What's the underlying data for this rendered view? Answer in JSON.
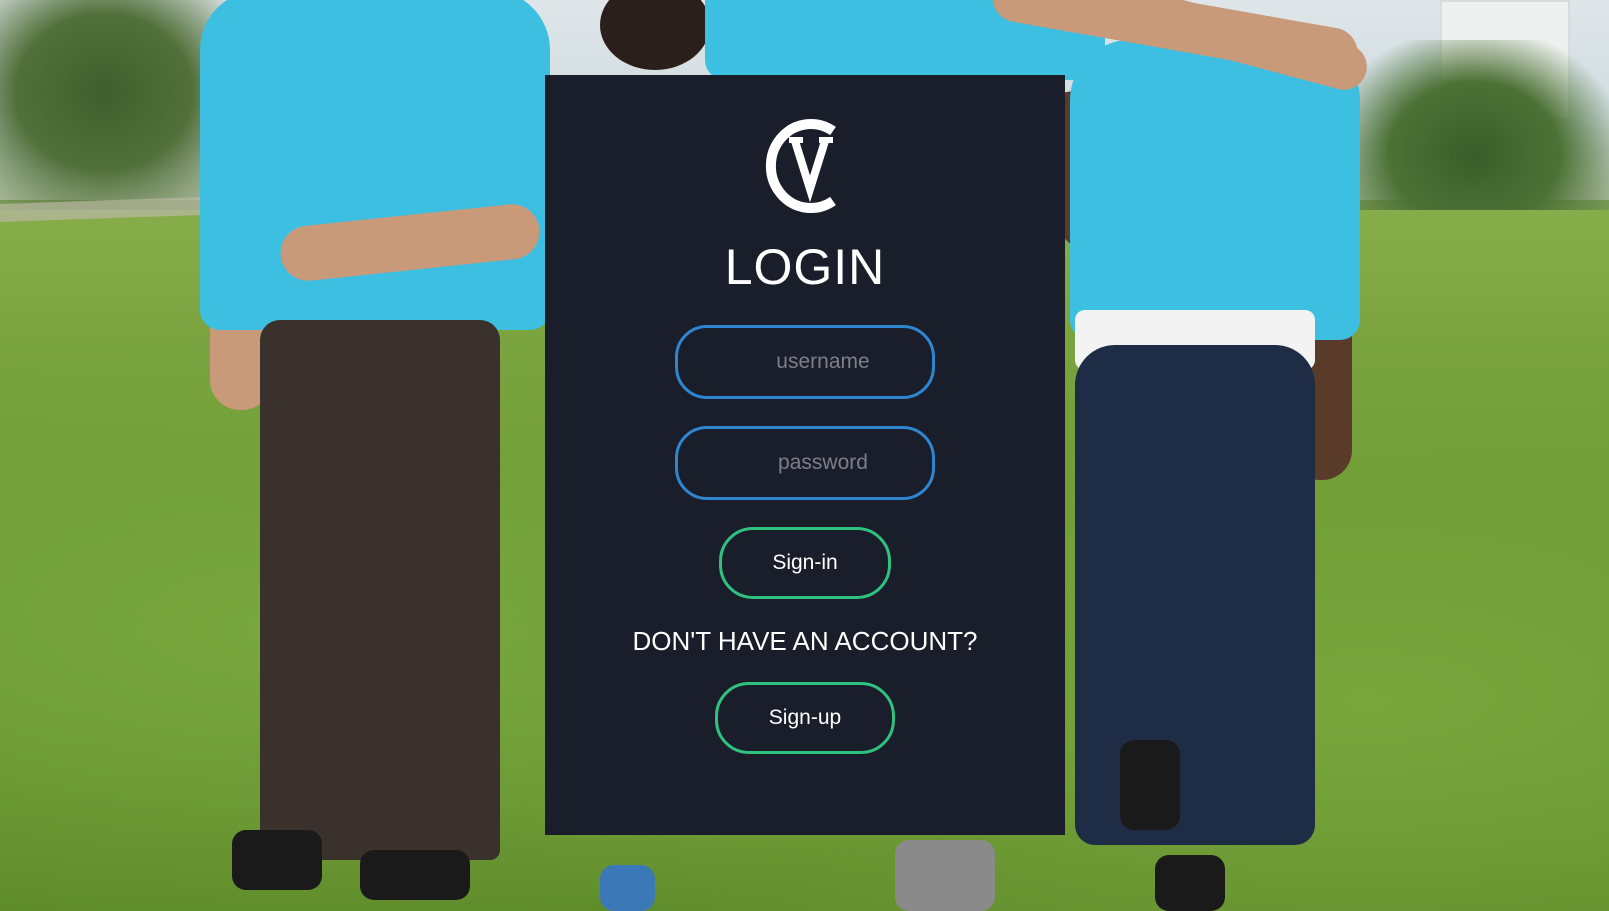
{
  "login": {
    "title": "LOGIN",
    "username_placeholder": "username",
    "password_placeholder": "password",
    "signin_label": "Sign-in",
    "prompt": "DON'T HAVE AN ACCOUNT?",
    "signup_label": "Sign-up"
  },
  "colors": {
    "panel_background": "#1a1e2b",
    "input_border": "#2e86d0",
    "button_border": "#2ec27e",
    "text": "#ffffff"
  }
}
